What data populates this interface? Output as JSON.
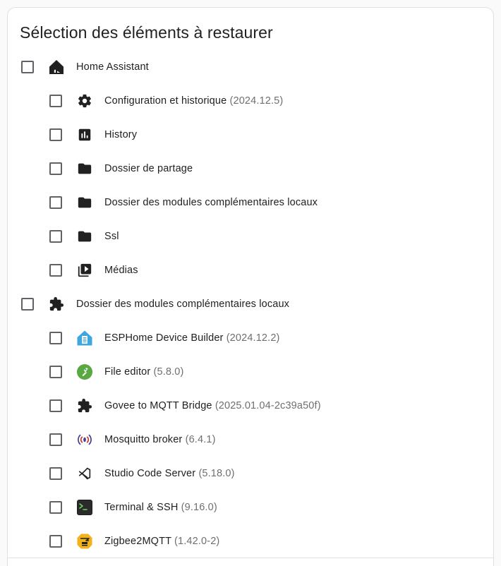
{
  "title": "Sélection des éléments à restaurer",
  "groups": [
    {
      "label": "Home Assistant",
      "icon": "home-assistant-icon",
      "items": [
        {
          "label": "Configuration et historique",
          "version": "(2024.12.5)",
          "icon": "gear-icon"
        },
        {
          "label": "History",
          "version": "",
          "icon": "chart-box-icon"
        },
        {
          "label": "Dossier de partage",
          "version": "",
          "icon": "folder-icon"
        },
        {
          "label": "Dossier des modules complémentaires locaux",
          "version": "",
          "icon": "folder-icon"
        },
        {
          "label": "Ssl",
          "version": "",
          "icon": "folder-icon"
        },
        {
          "label": "Médias",
          "version": "",
          "icon": "play-box-multiple-icon"
        }
      ]
    },
    {
      "label": "Dossier des modules complémentaires locaux",
      "icon": "puzzle-icon",
      "items": [
        {
          "label": "ESPHome Device Builder",
          "version": "(2024.12.2)",
          "icon": "esphome-icon"
        },
        {
          "label": "File editor",
          "version": "(5.8.0)",
          "icon": "wrench-icon"
        },
        {
          "label": "Govee to MQTT Bridge",
          "version": "(2025.01.04-2c39a50f)",
          "icon": "puzzle-icon"
        },
        {
          "label": "Mosquitto broker",
          "version": "(6.4.1)",
          "icon": "mosquitto-icon"
        },
        {
          "label": "Studio Code Server",
          "version": "(5.18.0)",
          "icon": "vscode-icon"
        },
        {
          "label": "Terminal & SSH",
          "version": "(9.16.0)",
          "icon": "terminal-icon"
        },
        {
          "label": "Zigbee2MQTT",
          "version": "(1.42.0-2)",
          "icon": "zigbee2mqtt-icon"
        }
      ]
    }
  ],
  "colors": {
    "checkbox_border": "#5f6368",
    "text": "#212121",
    "version_text": "#6f6f6f",
    "esphome_blue": "#3fa7e0",
    "file_editor_green": "#5aa842",
    "mosquitto_purple": "#4a3a8a",
    "mosquitto_red": "#c0392b",
    "zigbee_yellow": "#f2b21a"
  }
}
